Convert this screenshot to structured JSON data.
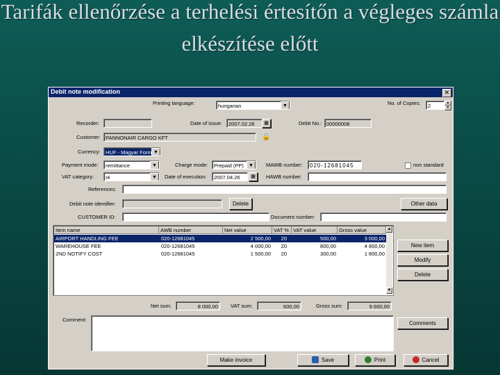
{
  "slide": {
    "title": "Tarifák ellenőrzése a terhelési értesítőn a végleges számla elkészítése előtt"
  },
  "window": {
    "title": "Debit note modification",
    "close_symbol": "✕"
  },
  "form": {
    "printing_language_label": "Printing language:",
    "printing_language_value": "hungarian",
    "num_copies_label": "No. of Copies:",
    "num_copies_value": "2",
    "recorder_label": "Recorder:",
    "recorder_value": "",
    "date_of_issue_label": "Date of issue:",
    "date_of_issue_value": "2007.02.26",
    "debit_no_label": "Debit No.:",
    "debit_no_value": "00000008",
    "customer_label": "Customer:",
    "customer_value": "PANNONAIR CARGO KFT",
    "currency_label": "Currency:",
    "currency_value": "HUF - Magyar Forint",
    "payment_mode_label": "Payment mode:",
    "payment_mode_value": "remittance",
    "charge_mode_label": "Charge mode:",
    "charge_mode_value": "Prepaid (PP)",
    "mawb_number_label": "MAWB number:",
    "mawb_number_value": "020-12681045",
    "non_standard_label": "non standard",
    "vat_category_label": "VAT category:",
    "vat_category_value": "I4",
    "date_of_execution_label": "Date of execution:",
    "date_of_execution_value": "2007.04.26",
    "hawb_number_label": "HAWB number:",
    "hawb_number_value": "",
    "references_label": "References:",
    "references_value": "",
    "debit_identifier_label": "Debit note identifier:",
    "debit_identifier_value": "",
    "delete_label": "Delete",
    "other_data_label": "Other data",
    "customer_id_label": "CUSTOMER ID:",
    "customer_id_value": "",
    "document_number_label": "Document number:",
    "document_number_value": ""
  },
  "table": {
    "columns": [
      "Item name",
      "AWB number",
      "Net value",
      "VAT %",
      "VAT value",
      "Gross value"
    ],
    "rows": [
      [
        "AIRPORT HANDLING FEE",
        "020-12681045",
        "2 500,00",
        "20",
        "500,00",
        "3 000,00"
      ],
      [
        "WAREHOUSE FEE",
        "020-12681045",
        "4 000,00",
        "20",
        "800,00",
        "4 800,00"
      ],
      [
        "2ND NOTIFY COST",
        "020-12681045",
        "1 500,00",
        "20",
        "300,00",
        "1 800,00"
      ]
    ]
  },
  "side_buttons": {
    "new_item": "New item",
    "modify": "Modify",
    "delete": "Delete",
    "comments": "Comments"
  },
  "totals": {
    "net_sum_label": "Net sum:",
    "net_sum_value": "8 000,00",
    "vat_sum_label": "VAT sum:",
    "vat_sum_value": "600,00",
    "gross_sum_label": "Gross sum:",
    "gross_sum_value": "9 600,00"
  },
  "comment": {
    "label": "Comment:",
    "value": ""
  },
  "bottom_buttons": {
    "make_invoice": "Make invoice",
    "save": "Save",
    "print": "Print",
    "cancel": "Cancel"
  },
  "colors": {
    "selection": "#0a246a",
    "save_icon": "#2a5fb0",
    "print_icon": "#2e7d32",
    "cancel_icon": "#c62828"
  }
}
